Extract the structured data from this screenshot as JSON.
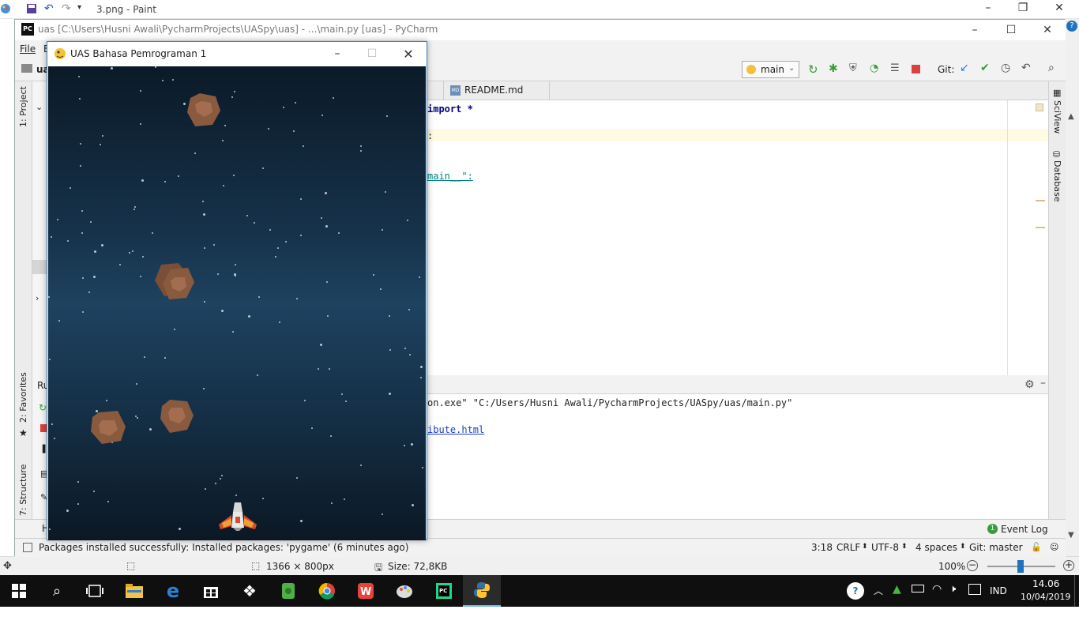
{
  "paint": {
    "title": "3.png - Paint",
    "dimensions": "1366 × 800px",
    "size": "Size: 72,8KB",
    "zoom": "100%"
  },
  "pycharm": {
    "title": "uas [C:\\Users\\Husni Awali\\PycharmProjects\\UASpy\\uas] - ...\\main.py [uas] - PyCharm",
    "menu_file": "File",
    "menu_partial": "E",
    "project_label": "ua",
    "run_config": "main",
    "git_label": "Git:",
    "tab_readme": "README.md",
    "code_lines": [
      "import *",
      ":",
      "main__\":"
    ],
    "run_label": "Ru",
    "output_line1": "on.exe\" \"C:/Users/Husni Awali/PycharmProjects/UASpy/uas/main.py\"",
    "output_line2": "ibute.html",
    "left_tabs": [
      "1: Project",
      "2: Favorites",
      "7: Structure"
    ],
    "right_tabs": [
      "SciView",
      "Database"
    ],
    "event_log": "Event Log",
    "event_count": "1",
    "status_message": "Packages installed successfully: Installed packages: 'pygame' (6 minutes ago)",
    "cursor_pos": "3:18",
    "line_sep": "CRLF",
    "encoding": "UTF-8",
    "indent": "4 spaces",
    "git_branch": "Git: master"
  },
  "game": {
    "title": "UAS Bahasa Pemrograman 1"
  },
  "taskbar": {
    "language": "IND",
    "time": "14.06",
    "date": "10/04/2019"
  },
  "colors": {
    "accent": "#3c7fb1",
    "asteroid": "#8a5a3f",
    "asteroid_light": "#a36d4f",
    "taskbar": "#0f0f0f"
  }
}
